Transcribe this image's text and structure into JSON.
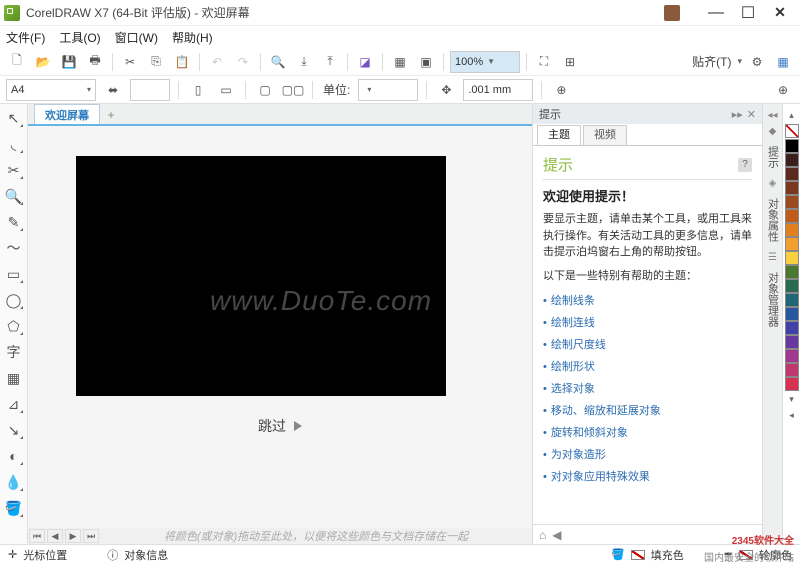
{
  "titlebar": {
    "title": "CorelDRAW X7 (64-Bit 评估版) - 欢迎屏幕"
  },
  "menu": {
    "file": "文件(F)",
    "tools": "工具(O)",
    "window": "窗口(W)",
    "help": "帮助(H)"
  },
  "toolbar": {
    "zoom": "100%",
    "paste": "贴齐(T)"
  },
  "props": {
    "pagesize": "A4",
    "units_label": "单位:",
    "nudge": ".001 mm"
  },
  "tabs": {
    "welcome": "欢迎屏幕"
  },
  "welcome": {
    "skip": "跳过"
  },
  "colorhint": "将颜色(或对象)拖动至此处，以便将这些颜色与文档存储在一起",
  "hints": {
    "panel_title": "提示",
    "tab_topic": "主题",
    "tab_video": "视频",
    "heading": "提示",
    "welcome_title": "欢迎使用提示！",
    "para": "要显示主题，请单击某个工具，或用工具来执行操作。有关活动工具的更多信息，请单击提示泊坞窗右上角的帮助按钮。",
    "subhead": "以下是一些特别有帮助的主题：",
    "topics": [
      "绘制线条",
      "绘制连线",
      "绘制尺度线",
      "绘制形状",
      "选择对象",
      "移动、缩放和延展对象",
      "旋转和倾斜对象",
      "为对象造形",
      "对对象应用特殊效果"
    ]
  },
  "rdock": {
    "hints": "提示",
    "props": "对象属性",
    "mgr": "对象管理器"
  },
  "status": {
    "cursor": "光标位置",
    "obj": "对象信息",
    "fill": "填充色",
    "outline": "轮廓色"
  },
  "palette": [
    "#000000",
    "#3a1f1a",
    "#5a2b1e",
    "#7a3820",
    "#9c4a20",
    "#c05a1a",
    "#e08020",
    "#f0a030",
    "#f8d040",
    "#4a7a30",
    "#2a6a50",
    "#206878",
    "#2858a0",
    "#4040a8",
    "#6838a0",
    "#a03890",
    "#c03870",
    "#d83050"
  ],
  "footer": {
    "l1": "2345软件大全",
    "l2": "国内最安全的软件站"
  },
  "watermark": "www.DuoTe.com"
}
